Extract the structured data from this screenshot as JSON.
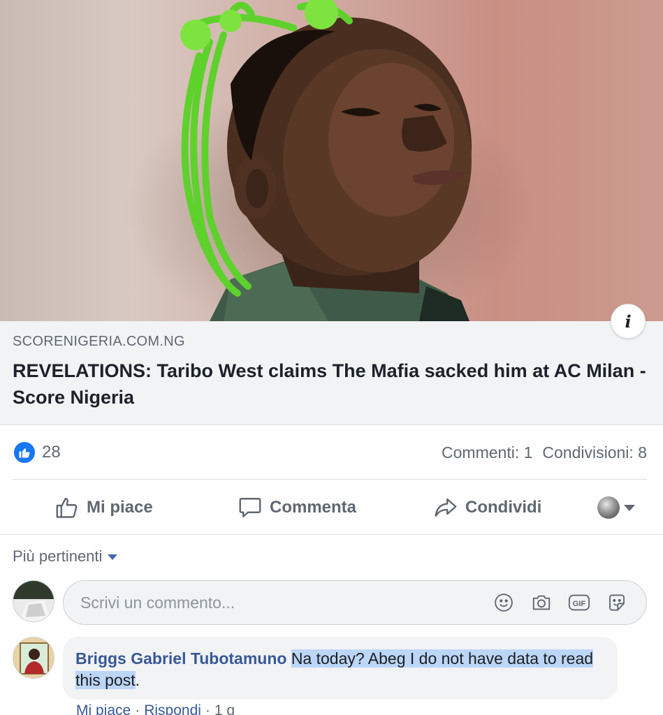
{
  "post": {
    "link": {
      "domain": "SCORENIGERIA.COM.NG",
      "title": "REVELATIONS: Taribo West claims The Mafia sacked him at AC Milan - Score Nigeria"
    },
    "stats": {
      "likes": "28",
      "comments": "Commenti: 1",
      "shares": "Condivisioni: 8"
    },
    "actions": {
      "like": "Mi piace",
      "comment": "Commenta",
      "share": "Condividi"
    }
  },
  "comments_section": {
    "sort_label": "Più pertinenti",
    "composer_placeholder": "Scrivi un commento...",
    "composer_icons": [
      "emoji-icon",
      "camera-icon",
      "gif-icon",
      "sticker-icon"
    ],
    "comment": {
      "author": "Briggs Gabriel Tubotamuno",
      "text_selected": "Na today? Abeg I do not have data to read this post",
      "text_rest": ".",
      "like_label": "Mi piace",
      "reply_label": "Rispondi",
      "time": "1 g"
    }
  },
  "colors": {
    "like_blue": "#1877f2",
    "link_blue": "#385898",
    "selection": "#bcd6f7"
  }
}
